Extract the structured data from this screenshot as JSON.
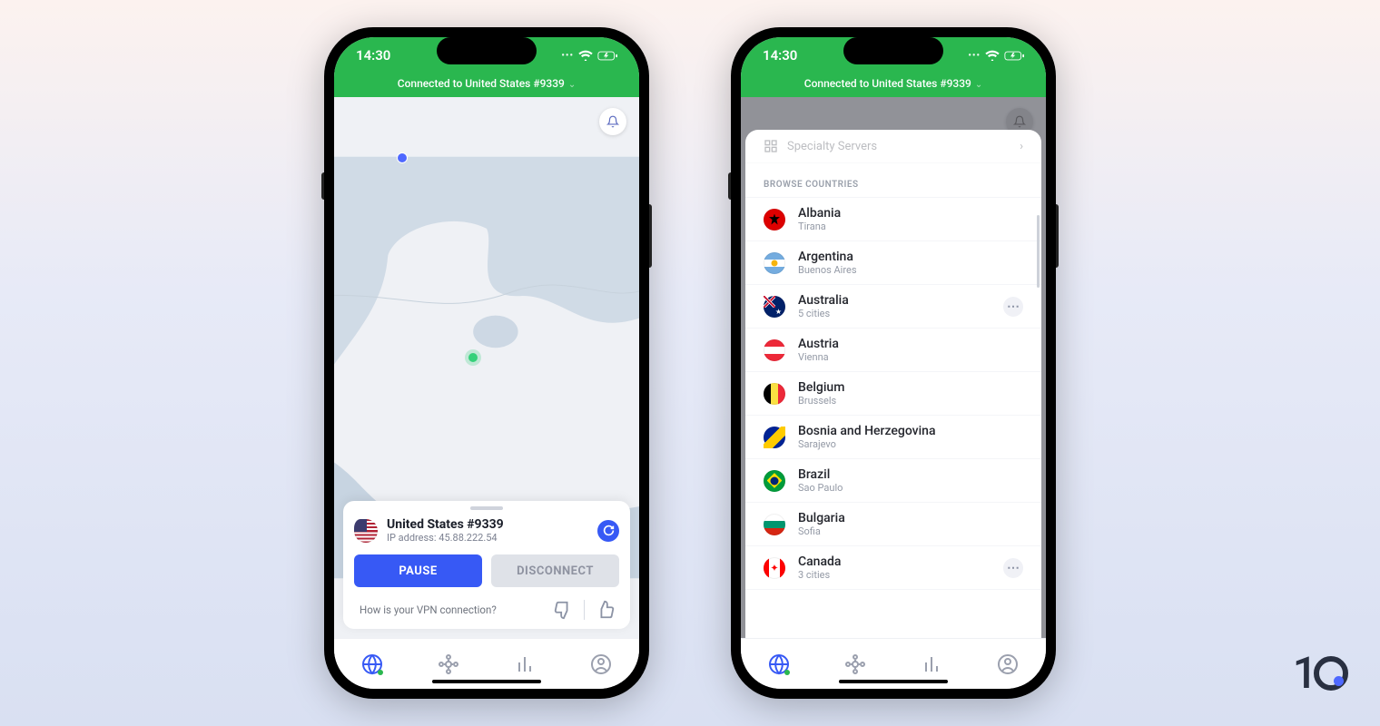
{
  "statusbar": {
    "time": "14:30"
  },
  "header": {
    "connected_text": "Connected to United States #9339"
  },
  "map": {
    "bell_icon": "bell-icon"
  },
  "card": {
    "server_name": "United States #9339",
    "ip_label": "IP address: 45.88.222.54",
    "pause_label": "PAUSE",
    "disconnect_label": "DISCONNECT",
    "feedback_question": "How is your VPN connection?"
  },
  "sheet": {
    "specialty_label": "Specialty Servers",
    "section_label": "BROWSE COUNTRIES",
    "countries": [
      {
        "name": "Albania",
        "sub": "Tirana",
        "flag": "flag-al",
        "more": false
      },
      {
        "name": "Argentina",
        "sub": "Buenos Aires",
        "flag": "flag-ar",
        "more": false
      },
      {
        "name": "Australia",
        "sub": "5 cities",
        "flag": "flag-au",
        "more": true
      },
      {
        "name": "Austria",
        "sub": "Vienna",
        "flag": "flag-at",
        "more": false
      },
      {
        "name": "Belgium",
        "sub": "Brussels",
        "flag": "flag-be",
        "more": false
      },
      {
        "name": "Bosnia and Herzegovina",
        "sub": "Sarajevo",
        "flag": "flag-ba",
        "more": false
      },
      {
        "name": "Brazil",
        "sub": "Sao Paulo",
        "flag": "flag-br",
        "more": false
      },
      {
        "name": "Bulgaria",
        "sub": "Sofia",
        "flag": "flag-bg",
        "more": false
      },
      {
        "name": "Canada",
        "sub": "3 cities",
        "flag": "flag-ca",
        "more": true
      }
    ]
  },
  "brand": {
    "text": "1"
  }
}
